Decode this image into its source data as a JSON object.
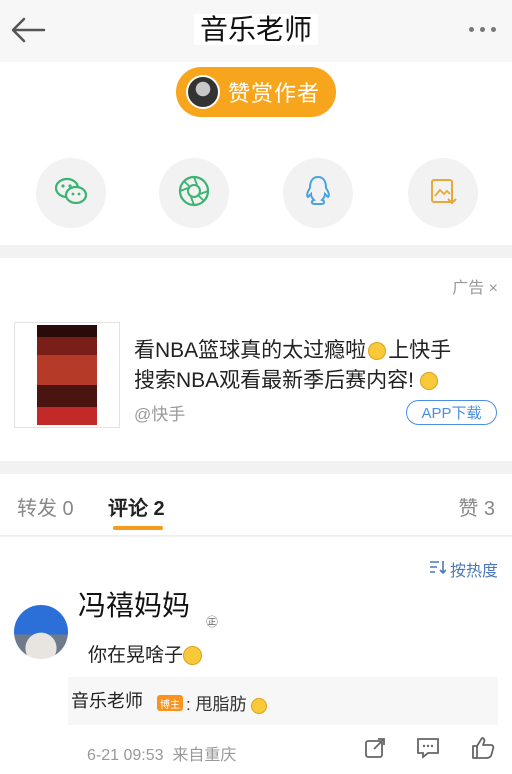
{
  "header": {
    "title": "音乐老师"
  },
  "reward": {
    "label": "赞赏作者"
  },
  "share": {
    "items": [
      "wechat-icon",
      "moments-icon",
      "qq-icon",
      "save-image-icon"
    ],
    "colors": {
      "wechat": "#3cb371",
      "moments": "#3cb371",
      "qq": "#4aa3df",
      "save": "#e7a93a"
    }
  },
  "ad": {
    "label": "广告",
    "close": "×",
    "text_line1": "看NBA篮球真的太过瘾啦",
    "text_line1_suffix": "上快手",
    "text_line2": "搜索NBA观看最新季后赛内容!",
    "source": "@快手",
    "button": "APP下载"
  },
  "tabs": {
    "repost": "转发 0",
    "comments": "评论 2",
    "likes": "赞 3"
  },
  "comments": {
    "sort_label": "按热度",
    "items": [
      {
        "username": "冯禧妈妈",
        "user_mark": "㊣",
        "text": "你在晃啥子",
        "reply": {
          "author": "音乐老师",
          "badge": "博主",
          "text": ": 甩脂肪"
        },
        "time": "6-21 09:53",
        "location": "来自重庆"
      }
    ]
  },
  "accent": "#f7a51c"
}
